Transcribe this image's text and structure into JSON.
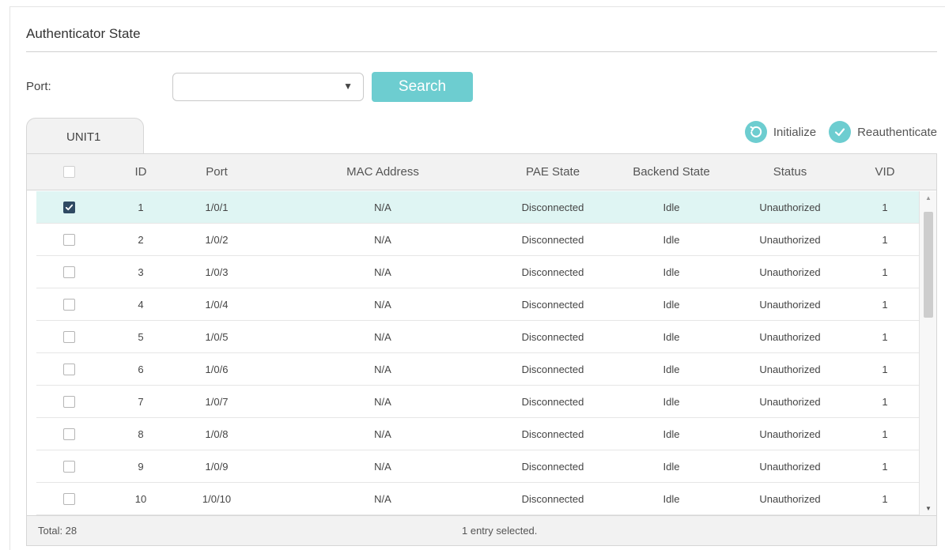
{
  "section": {
    "title": "Authenticator State"
  },
  "filter": {
    "port_label": "Port:",
    "port_value": "",
    "search_label": "Search"
  },
  "tabs": [
    {
      "label": "UNIT1"
    }
  ],
  "actions": {
    "initialize_label": "Initialize",
    "reauthenticate_label": "Reauthenticate"
  },
  "colors": {
    "accent": "#6dcdd0",
    "selected_row": "#dff5f3",
    "checkbox_checked": "#2f4a63"
  },
  "table": {
    "columns": [
      "ID",
      "Port",
      "MAC Address",
      "PAE State",
      "Backend State",
      "Status",
      "VID"
    ],
    "rows": [
      {
        "checked": true,
        "id": "1",
        "port": "1/0/1",
        "mac": "N/A",
        "pae": "Disconnected",
        "backend": "Idle",
        "status": "Unauthorized",
        "vid": "1"
      },
      {
        "checked": false,
        "id": "2",
        "port": "1/0/2",
        "mac": "N/A",
        "pae": "Disconnected",
        "backend": "Idle",
        "status": "Unauthorized",
        "vid": "1"
      },
      {
        "checked": false,
        "id": "3",
        "port": "1/0/3",
        "mac": "N/A",
        "pae": "Disconnected",
        "backend": "Idle",
        "status": "Unauthorized",
        "vid": "1"
      },
      {
        "checked": false,
        "id": "4",
        "port": "1/0/4",
        "mac": "N/A",
        "pae": "Disconnected",
        "backend": "Idle",
        "status": "Unauthorized",
        "vid": "1"
      },
      {
        "checked": false,
        "id": "5",
        "port": "1/0/5",
        "mac": "N/A",
        "pae": "Disconnected",
        "backend": "Idle",
        "status": "Unauthorized",
        "vid": "1"
      },
      {
        "checked": false,
        "id": "6",
        "port": "1/0/6",
        "mac": "N/A",
        "pae": "Disconnected",
        "backend": "Idle",
        "status": "Unauthorized",
        "vid": "1"
      },
      {
        "checked": false,
        "id": "7",
        "port": "1/0/7",
        "mac": "N/A",
        "pae": "Disconnected",
        "backend": "Idle",
        "status": "Unauthorized",
        "vid": "1"
      },
      {
        "checked": false,
        "id": "8",
        "port": "1/0/8",
        "mac": "N/A",
        "pae": "Disconnected",
        "backend": "Idle",
        "status": "Unauthorized",
        "vid": "1"
      },
      {
        "checked": false,
        "id": "9",
        "port": "1/0/9",
        "mac": "N/A",
        "pae": "Disconnected",
        "backend": "Idle",
        "status": "Unauthorized",
        "vid": "1"
      },
      {
        "checked": false,
        "id": "10",
        "port": "1/0/10",
        "mac": "N/A",
        "pae": "Disconnected",
        "backend": "Idle",
        "status": "Unauthorized",
        "vid": "1"
      }
    ]
  },
  "footer": {
    "total": "Total: 28",
    "selection": "1 entry selected."
  }
}
